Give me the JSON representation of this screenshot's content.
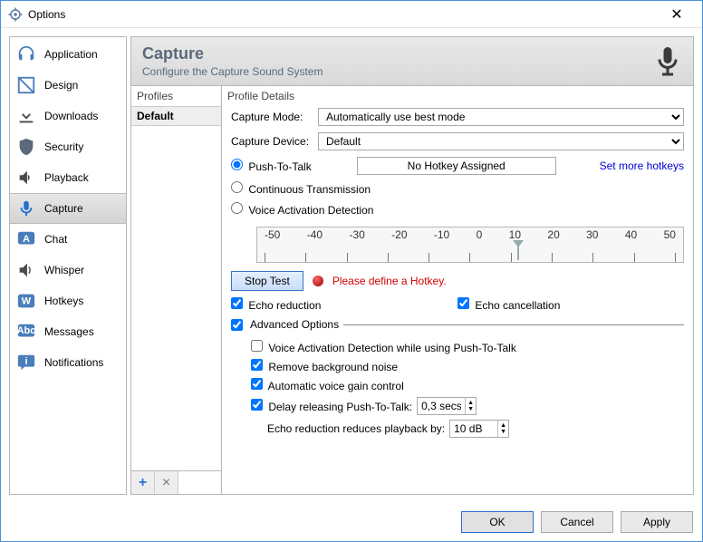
{
  "window": {
    "title": "Options"
  },
  "sidebar": {
    "items": [
      {
        "label": "Application"
      },
      {
        "label": "Design"
      },
      {
        "label": "Downloads"
      },
      {
        "label": "Security"
      },
      {
        "label": "Playback"
      },
      {
        "label": "Capture"
      },
      {
        "label": "Chat"
      },
      {
        "label": "Whisper"
      },
      {
        "label": "Hotkeys"
      },
      {
        "label": "Messages"
      },
      {
        "label": "Notifications"
      }
    ]
  },
  "header": {
    "title": "Capture",
    "subtitle": "Configure the Capture Sound System"
  },
  "profiles": {
    "heading": "Profiles",
    "items": [
      {
        "label": "Default"
      }
    ],
    "add_tooltip": "+",
    "remove_tooltip": "×"
  },
  "details": {
    "heading": "Profile Details",
    "capture_mode": {
      "label": "Capture Mode:",
      "value": "Automatically use best mode"
    },
    "capture_device": {
      "label": "Capture Device:",
      "value": "Default"
    },
    "modes": {
      "ptt": "Push-To-Talk",
      "ct": "Continuous Transmission",
      "vad": "Voice Activation Detection"
    },
    "hotkey_field": "No Hotkey Assigned",
    "set_more_hotkeys": "Set more hotkeys",
    "gauge_ticks": [
      "-50",
      "-40",
      "-30",
      "-20",
      "-10",
      "0",
      "10",
      "20",
      "30",
      "40",
      "50"
    ],
    "stop_test": "Stop Test",
    "error_text": "Please define a Hotkey.",
    "echo_reduction": "Echo reduction",
    "echo_cancellation": "Echo cancellation",
    "advanced_label": "Advanced Options",
    "adv": {
      "vad_ptt": "Voice Activation Detection while using Push-To-Talk",
      "remove_bg": "Remove background noise",
      "agc": "Automatic voice gain control",
      "delay_ptt_label": "Delay releasing Push-To-Talk:",
      "delay_ptt_value": "0,3 secs",
      "echo_reduce_label": "Echo reduction reduces playback by:",
      "echo_reduce_value": "10 dB"
    }
  },
  "footer": {
    "ok": "OK",
    "cancel": "Cancel",
    "apply": "Apply"
  }
}
